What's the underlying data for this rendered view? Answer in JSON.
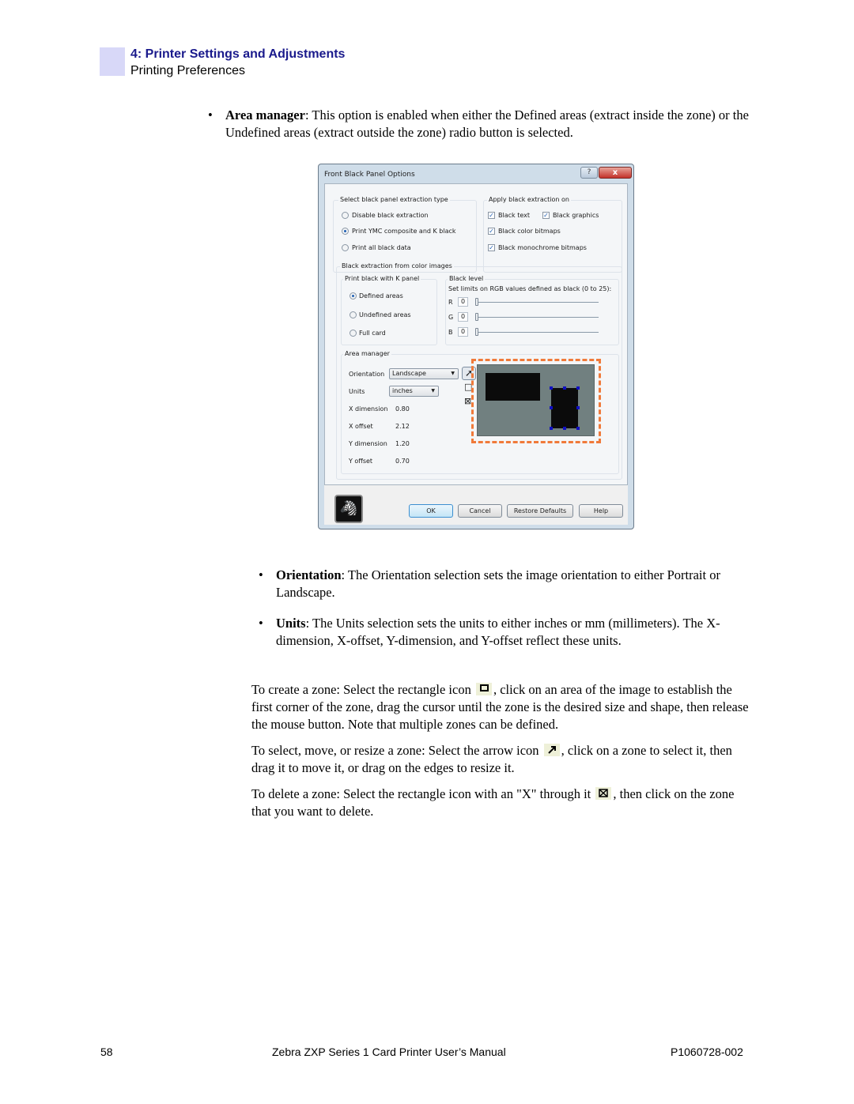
{
  "header": {
    "chapter_title": "4: Printer Settings and Adjustments",
    "section_title": "Printing Preferences"
  },
  "bullets_top": [
    {
      "term": "Area manager",
      "text": ": This option is enabled when either the Defined areas (extract inside the zone) or the Undefined areas (extract outside the zone) radio button is selected."
    }
  ],
  "dialog": {
    "title": "Front Black Panel Options",
    "help_button": "?",
    "close_button": "x",
    "extraction_type": {
      "label": "Select black panel extraction type",
      "options": [
        {
          "label": "Disable black extraction",
          "selected": false
        },
        {
          "label": "Print YMC composite and K black",
          "selected": true
        },
        {
          "label": "Print all black data",
          "selected": false
        }
      ]
    },
    "apply_on": {
      "label": "Apply black extraction on",
      "checkboxes": [
        {
          "label": "Black text",
          "checked": true
        },
        {
          "label": "Black graphics",
          "checked": true
        },
        {
          "label": "Black color bitmaps",
          "checked": true
        },
        {
          "label": "Black monochrome bitmaps",
          "checked": true
        }
      ],
      "check_glyph": "✓"
    },
    "color_images": {
      "label": "Black extraction from color images",
      "k_panel": {
        "label": "Print black with K panel",
        "options": [
          {
            "label": "Defined areas",
            "selected": true
          },
          {
            "label": "Undefined areas",
            "selected": false
          },
          {
            "label": "Full card",
            "selected": false
          }
        ]
      },
      "black_level": {
        "label": "Black level",
        "hint": "Set limits on RGB values defined as black (0 to 25):",
        "channels": [
          {
            "name": "R",
            "value": "0"
          },
          {
            "name": "G",
            "value": "0"
          },
          {
            "name": "B",
            "value": "0"
          }
        ]
      }
    },
    "area_manager": {
      "label": "Area manager",
      "orientation_label": "Orientation",
      "orientation_value": "Landscape",
      "units_label": "Units",
      "units_value": "inches",
      "fields": [
        {
          "label": "X dimension",
          "value": "0.80"
        },
        {
          "label": "X offset",
          "value": "2.12"
        },
        {
          "label": "Y dimension",
          "value": "1.20"
        },
        {
          "label": "Y offset",
          "value": "0.70"
        }
      ],
      "tools": {
        "arrow_glyph": "➚",
        "rect_glyph": "□",
        "delete_glyph": "⊠"
      },
      "dropdown_glyph": "▼"
    },
    "buttons": {
      "ok": "OK",
      "cancel": "Cancel",
      "restore_defaults": "Restore Defaults",
      "help": "Help"
    },
    "logo_glyph": "🦓"
  },
  "bullets_mid": [
    {
      "term": "Orientation",
      "text": ": The Orientation selection sets the image orientation to either Portrait or Landscape."
    },
    {
      "term": "Units",
      "text": ": The Units selection sets the units to either inches or mm (millimeters). The X-dimension, X-offset, Y-dimension, and Y-offset reflect these units."
    }
  ],
  "paragraphs": {
    "create_before": "To create a zone: Select the rectangle icon ",
    "create_after": ", click on an area of the image to establish the first corner of the zone, drag the cursor until the zone is the desired size and shape, then release the mouse button. Note that multiple zones can be defined.",
    "select_before": "To select, move, or resize a zone: Select the arrow icon ",
    "select_after": ", click on a zone to select it, then drag it to move it, or drag on the edges to resize it.",
    "delete_before": "To delete a zone: Select the rectangle icon with an \"X\" through it ",
    "delete_after": ", then click on the zone that you want to delete."
  },
  "bullet_glyph": "•",
  "footer": {
    "page_number": "58",
    "manual_title": "Zebra ZXP Series 1 Card Printer User’s Manual",
    "doc_number": "P1060728-002"
  }
}
